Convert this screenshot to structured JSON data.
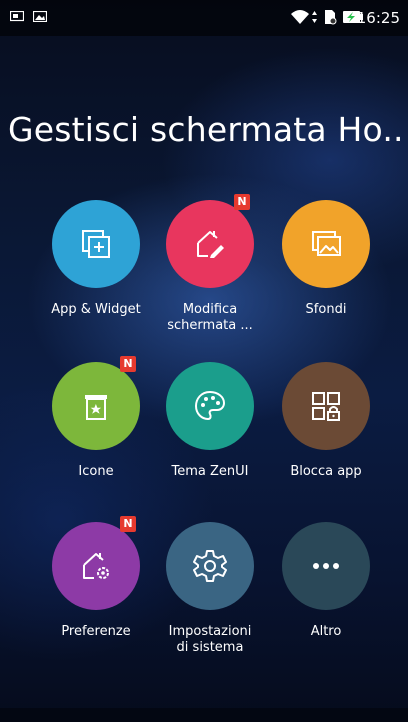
{
  "status_bar": {
    "time": "16:25",
    "icons": [
      "screen-cast-icon",
      "image-icon",
      "wifi-icon",
      "data-arrows-icon",
      "sd-card-icon",
      "battery-charging-icon"
    ]
  },
  "page": {
    "title": "Gestisci schermata Ho..."
  },
  "tiles": [
    {
      "label": "App & Widget",
      "color": "#2ea3d6",
      "icon": "app-widget-icon",
      "badge": ""
    },
    {
      "label": "Modifica schermata ...",
      "color": "#e8365e",
      "icon": "edit-home-icon",
      "badge": "N"
    },
    {
      "label": "Sfondi",
      "color": "#f1a32a",
      "icon": "wallpaper-icon",
      "badge": ""
    },
    {
      "label": "Icone",
      "color": "#7db73b",
      "icon": "icon-pack-icon",
      "badge": "N"
    },
    {
      "label": "Tema ZenUI",
      "color": "#1b9e8c",
      "icon": "palette-icon",
      "badge": ""
    },
    {
      "label": "Blocca app",
      "color": "#6b4a35",
      "icon": "app-lock-icon",
      "badge": ""
    },
    {
      "label": "Preferenze",
      "color": "#8d3aa6",
      "icon": "home-settings-icon",
      "badge": "N"
    },
    {
      "label": "Impostazioni di sistema",
      "color": "#3a6583",
      "icon": "gear-icon",
      "badge": ""
    },
    {
      "label": "Altro",
      "color": "#2a4858",
      "icon": "more-icon",
      "badge": ""
    }
  ]
}
